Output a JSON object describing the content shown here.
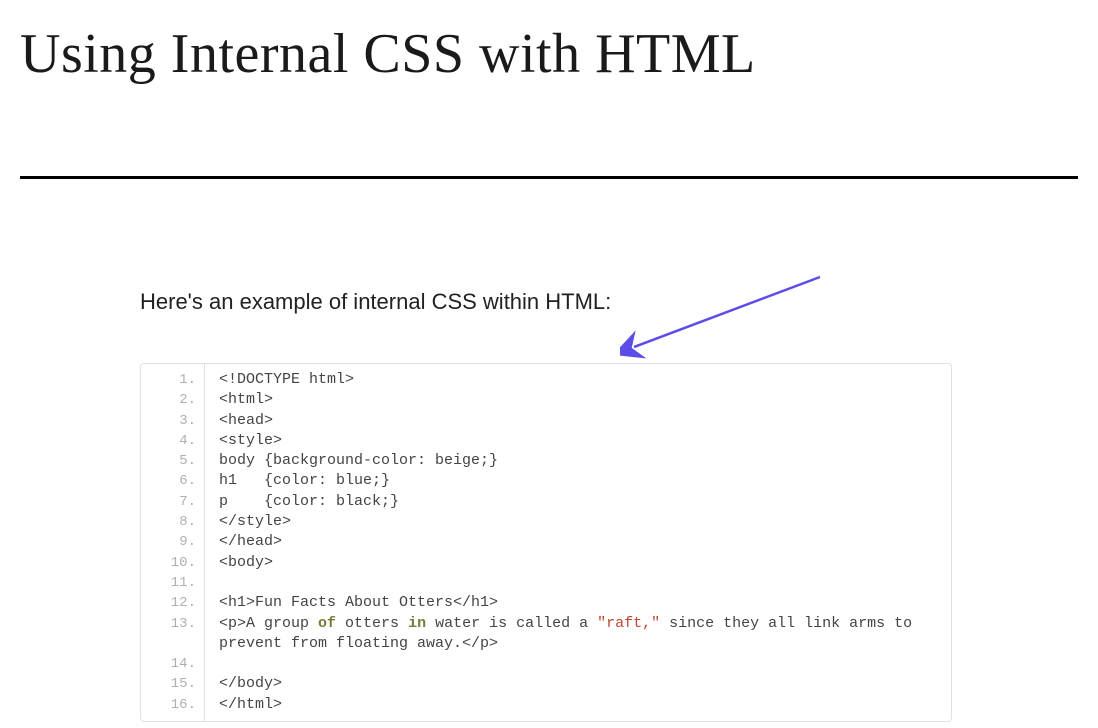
{
  "title": "Using Internal CSS with HTML",
  "intro": "Here's an example of internal CSS within HTML:",
  "code": {
    "lines": [
      "<!DOCTYPE html>",
      "<html>",
      "<head>",
      "<style>",
      "body {background-color: beige;}",
      "h1   {color: blue;}",
      "p    {color: black;}",
      "</style>",
      "</head>",
      "<body>",
      "",
      "<h1>Fun Facts About Otters</h1>",
      "<p>A group of otters in water is called a \"raft,\" since they all link arms to prevent from floating away.</p>",
      "",
      "</body>",
      "</html>"
    ],
    "line_numbers": [
      "1.",
      "2.",
      "3.",
      "4.",
      "5.",
      "6.",
      "7.",
      "8.",
      "9.",
      "10.",
      "11.",
      "12.",
      "13.",
      "14.",
      "15.",
      "16."
    ],
    "wrap_index": 12
  }
}
